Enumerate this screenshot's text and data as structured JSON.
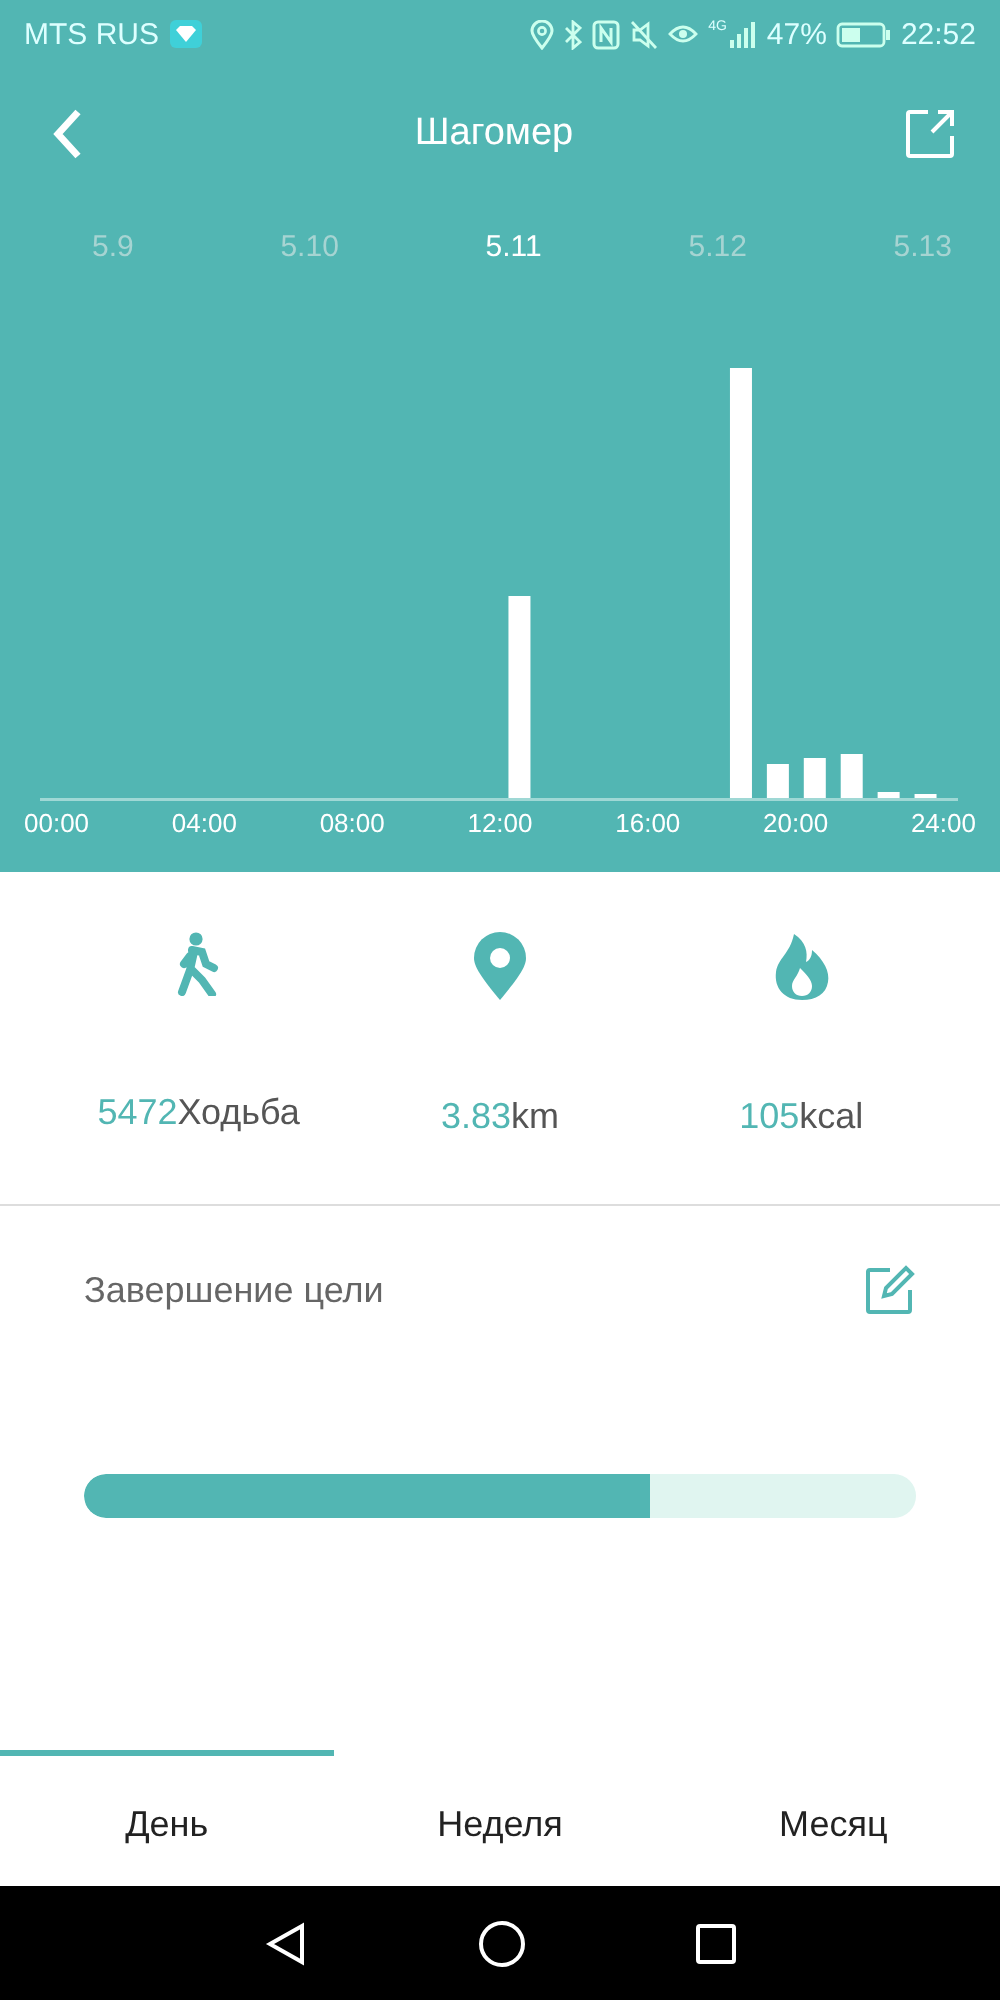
{
  "status_bar": {
    "carrier": "MTS RUS",
    "network": "4G",
    "battery": "47%",
    "time": "22:52"
  },
  "header": {
    "title": "Шагомер"
  },
  "dates": [
    {
      "label": "5.9",
      "selected": false
    },
    {
      "label": "5.10",
      "selected": false
    },
    {
      "label": "5.11",
      "selected": true
    },
    {
      "label": "5.12",
      "selected": false
    },
    {
      "label": "5.13",
      "selected": false
    }
  ],
  "chart": {
    "x_labels": [
      "00:00",
      "04:00",
      "08:00",
      "12:00",
      "16:00",
      "20:00",
      "24:00"
    ]
  },
  "stats": [
    {
      "kind": "steps",
      "value": "5472",
      "unit": "Ходьба"
    },
    {
      "kind": "distance",
      "value": "3.83",
      "unit": "km"
    },
    {
      "kind": "calories",
      "value": "105",
      "unit": "kcal"
    }
  ],
  "goal": {
    "title": "Завершение цели",
    "level": 0.68
  },
  "tabs": [
    {
      "label": "День",
      "selected": true
    },
    {
      "label": "Неделя",
      "selected": false
    },
    {
      "label": "Месяц",
      "selected": false
    }
  ]
}
